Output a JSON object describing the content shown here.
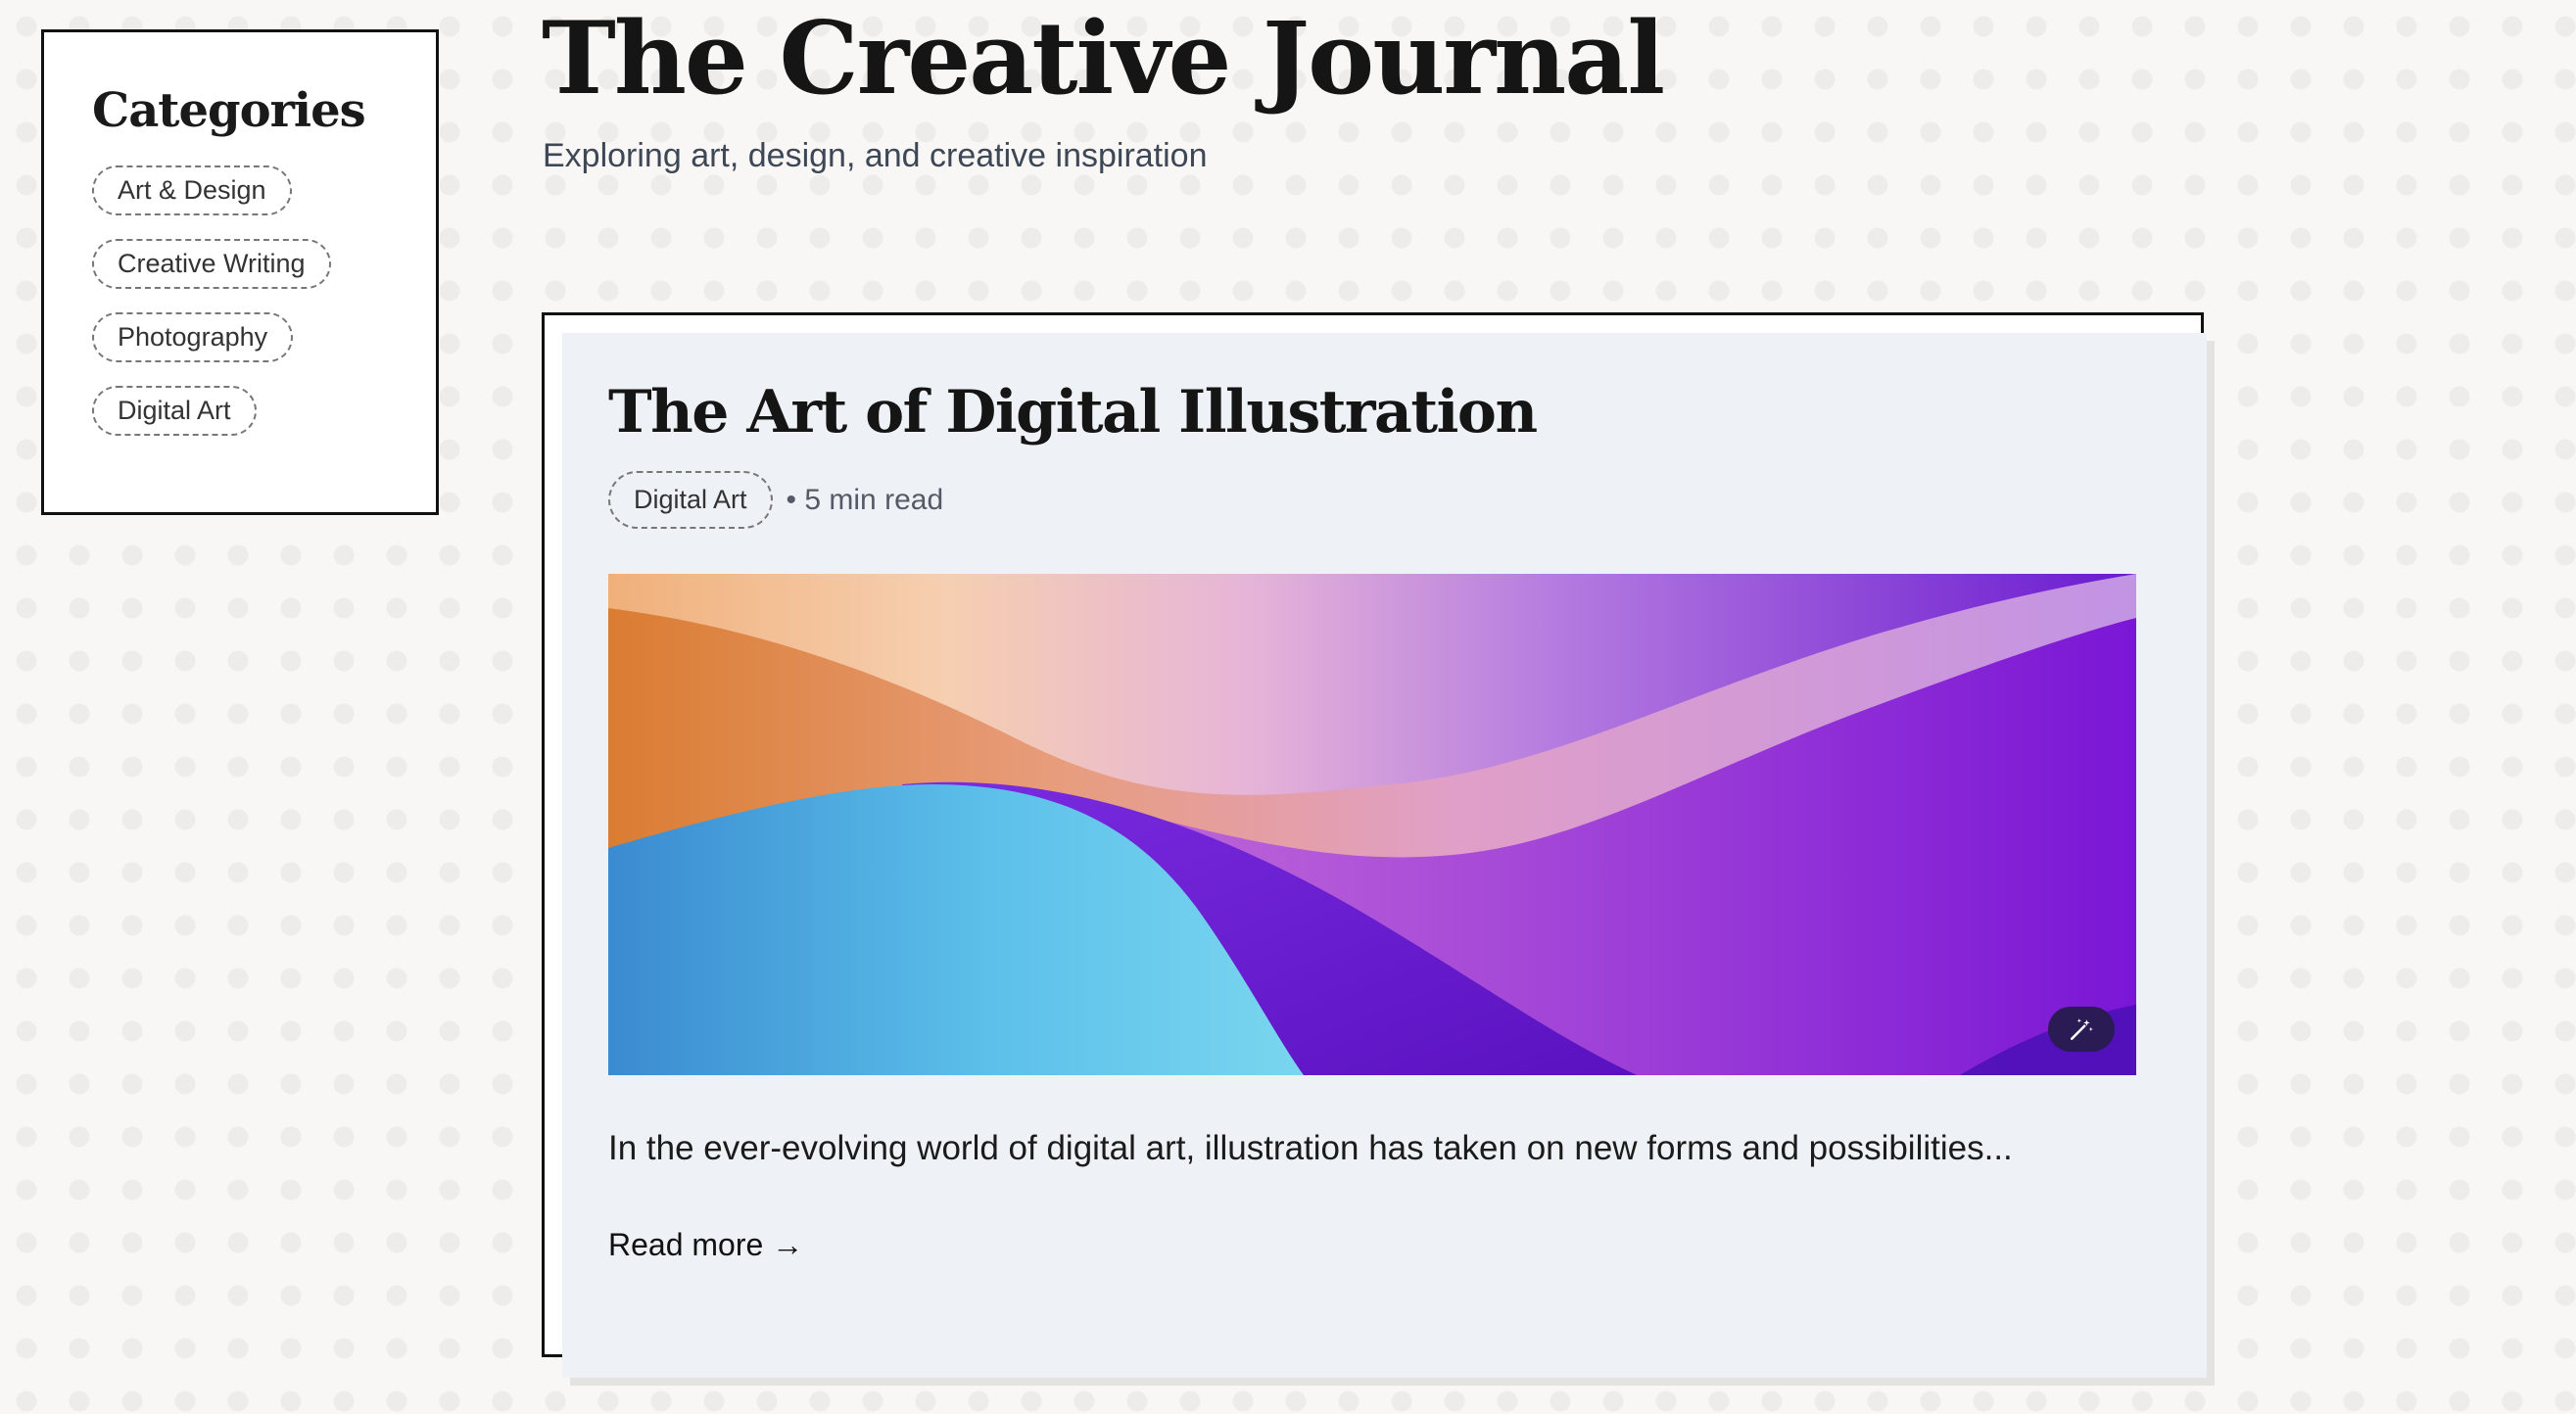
{
  "sidebar": {
    "title": "Categories",
    "categories": [
      {
        "label": "Art & Design"
      },
      {
        "label": "Creative Writing"
      },
      {
        "label": "Photography"
      },
      {
        "label": "Digital Art"
      }
    ]
  },
  "header": {
    "title": "The Creative Journal",
    "subtitle": "Exploring art, design, and creative inspiration"
  },
  "article": {
    "title": "The Art of Digital Illustration",
    "category": "Digital Art",
    "read_time": "• 5 min read",
    "excerpt": "In the ever-evolving world of digital art, illustration has taken on new forms and possibilities...",
    "read_more_label": "Read more →",
    "image_action_icon": "magic-wand-icon"
  },
  "colors": {
    "background": "#f8f7f5",
    "card": "#eef1f5",
    "border": "#111111",
    "subtitle": "#3d4756"
  }
}
